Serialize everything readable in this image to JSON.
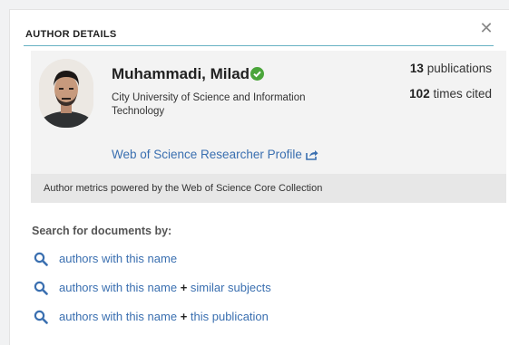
{
  "header": {
    "title": "AUTHOR DETAILS",
    "close_glyph": "✕"
  },
  "author": {
    "name": "Muhammadi, Milad",
    "affiliation": "City University of Science and Information Technology",
    "publications_count": "13",
    "publications_label": "publications",
    "cited_count": "102",
    "cited_label": "times cited",
    "profile_link": "Web of Science Researcher Profile"
  },
  "metrics_note": "Author metrics powered by the Web of Science Core Collection",
  "search": {
    "title": "Search for documents by:",
    "links": [
      {
        "text": "authors with this name",
        "plus": "",
        "suffix": ""
      },
      {
        "text": "authors with this name ",
        "plus": "+",
        "suffix": " similar subjects"
      },
      {
        "text": "authors with this name ",
        "plus": "+",
        "suffix": " this publication"
      }
    ]
  },
  "colors": {
    "link": "#3a6fb0",
    "accent_line": "#68b2c3",
    "verified": "#4aa53a"
  },
  "icons": {
    "close": "close-icon",
    "verified": "verified-check-icon",
    "external": "external-link-icon",
    "search": "search-icon"
  }
}
